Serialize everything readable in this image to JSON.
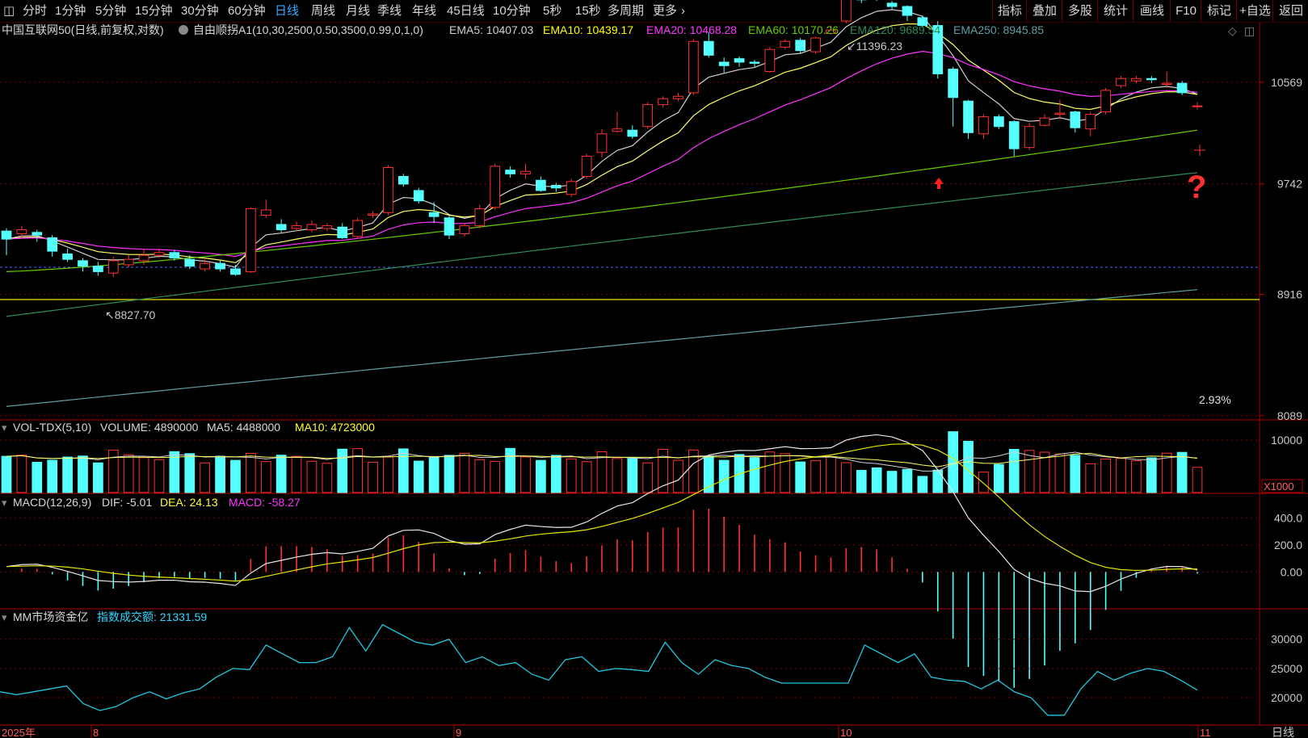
{
  "toolbar": {
    "menu_icon": "grid-icon",
    "periods": [
      "分时",
      "1分钟",
      "5分钟",
      "15分钟",
      "30分钟",
      "60分钟",
      "日线",
      "周线",
      "月线",
      "季线",
      "年线",
      "45日线",
      "10分钟",
      "5秒",
      "15秒",
      "多周期",
      "更多"
    ],
    "active_period": "日线",
    "right_buttons": [
      "指标",
      "叠加",
      "多股",
      "统计",
      "画线",
      "F10",
      "标记",
      "+自选",
      "返回"
    ]
  },
  "main_panel": {
    "title": "中国互联网50(日线,前复权,对数)",
    "indicator": "自由顺拐A1(10,30,2500,0.50,3500,0.99,0,1,0)",
    "ema_labels": [
      {
        "text": "EMA5: 10407.03",
        "color": "#d0d0d0"
      },
      {
        "text": "EMA10: 10439.17",
        "color": "#ffff00"
      },
      {
        "text": "EMA20: 10468.28",
        "color": "#ff33ff"
      },
      {
        "text": "EMA60: 10170.26",
        "color": "#66cc00"
      },
      {
        "text": "EMA120: 9689.54",
        "color": "#2e8b57"
      },
      {
        "text": "EMA250: 8945.85",
        "color": "#5f9ea0"
      }
    ],
    "y_ticks": [
      "10569",
      "9742",
      "8916",
      "8089"
    ],
    "high_label": "11396.23",
    "low_label": "8827.70",
    "pct_label": "2.93%",
    "annotation": "?"
  },
  "vol_panel": {
    "title": "VOL-TDX(5,10)",
    "volume": "VOLUME: 4890000",
    "ma5": "MA5: 4488000",
    "ma10": "MA10: 4723000",
    "y_ticks": [
      "10000"
    ],
    "unit": "X1000"
  },
  "macd_panel": {
    "title": "MACD(12,26,9)",
    "dif": "DIF: -5.01",
    "dea": "DEA: 24.13",
    "macd": "MACD: -58.27",
    "y_ticks": [
      "400.0",
      "200.0",
      "0.00"
    ]
  },
  "mm_panel": {
    "title": "MM市场资金亿",
    "label": "指数成交额: 21331.59",
    "y_ticks": [
      "30000",
      "25000",
      "20000"
    ]
  },
  "x_axis": {
    "year": "2025年",
    "months": [
      "8",
      "9",
      "10",
      "11"
    ],
    "period_label": "日线"
  },
  "chart_data": {
    "type": "candlestick",
    "title": "中国互联网50(日线,前复权,对数)",
    "y_scale": "log",
    "ylim": [
      8089,
      11000
    ],
    "candles": [
      [
        9380,
        9320,
        9400,
        9200
      ],
      [
        9360,
        9390,
        9420,
        9330
      ],
      [
        9370,
        9350,
        9390,
        9300
      ],
      [
        9330,
        9230,
        9350,
        9190
      ],
      [
        9210,
        9170,
        9250,
        9150
      ],
      [
        9160,
        9120,
        9180,
        9080
      ],
      [
        9120,
        9080,
        9150,
        9050
      ],
      [
        9070,
        9160,
        9190,
        9040
      ],
      [
        9130,
        9170,
        9200,
        9110
      ],
      [
        9160,
        9200,
        9250,
        9130
      ],
      [
        9200,
        9220,
        9250,
        9180
      ],
      [
        9220,
        9180,
        9240,
        9160
      ],
      [
        9170,
        9120,
        9200,
        9100
      ],
      [
        9100,
        9140,
        9170,
        9080
      ],
      [
        9140,
        9100,
        9160,
        9080
      ],
      [
        9100,
        9060,
        9130,
        9050
      ],
      [
        9080,
        9550,
        9560,
        9070
      ],
      [
        9500,
        9540,
        9620,
        9480
      ],
      [
        9430,
        9390,
        9470,
        9370
      ],
      [
        9400,
        9420,
        9450,
        9380
      ],
      [
        9390,
        9430,
        9460,
        9370
      ],
      [
        9400,
        9420,
        9440,
        9380
      ],
      [
        9410,
        9330,
        9440,
        9320
      ],
      [
        9340,
        9460,
        9480,
        9320
      ],
      [
        9500,
        9510,
        9530,
        9480
      ],
      [
        9520,
        9870,
        9890,
        9500
      ],
      [
        9800,
        9740,
        9820,
        9720
      ],
      [
        9690,
        9610,
        9710,
        9590
      ],
      [
        9520,
        9490,
        9600,
        9440
      ],
      [
        9480,
        9350,
        9500,
        9320
      ],
      [
        9360,
        9420,
        9440,
        9340
      ],
      [
        9420,
        9550,
        9580,
        9400
      ],
      [
        9560,
        9880,
        9900,
        9540
      ],
      [
        9850,
        9820,
        9880,
        9790
      ],
      [
        9820,
        9840,
        9900,
        9780
      ],
      [
        9770,
        9690,
        9800,
        9680
      ],
      [
        9730,
        9710,
        9750,
        9680
      ],
      [
        9660,
        9760,
        9780,
        9640
      ],
      [
        9800,
        9960,
        9980,
        9780
      ],
      [
        9990,
        10140,
        10180,
        9950
      ],
      [
        10160,
        10180,
        10320,
        10150
      ],
      [
        10170,
        10120,
        10210,
        10100
      ],
      [
        10200,
        10380,
        10400,
        10180
      ],
      [
        10380,
        10430,
        10450,
        10360
      ],
      [
        10430,
        10450,
        10480,
        10410
      ],
      [
        10480,
        10920,
        10940,
        10460
      ],
      [
        10920,
        10800,
        11000,
        10780
      ],
      [
        10740,
        10710,
        10780,
        10650
      ],
      [
        10770,
        10740,
        10790,
        10700
      ],
      [
        10740,
        10730,
        10760,
        10700
      ],
      [
        10660,
        10850,
        10870,
        10650
      ],
      [
        10870,
        10920,
        10940,
        10850
      ],
      [
        10930,
        10840,
        10950,
        10820
      ],
      [
        10830,
        10950,
        10960,
        10810
      ],
      [
        10990,
        11020,
        11060,
        10980
      ],
      [
        11100,
        11320,
        11340,
        11080
      ],
      [
        11310,
        11290,
        11320,
        11260
      ],
      [
        11320,
        11300,
        11340,
        11280
      ],
      [
        11260,
        11230,
        11280,
        11200
      ],
      [
        11230,
        11150,
        11240,
        11100
      ],
      [
        11130,
        11060,
        11150,
        11050
      ],
      [
        11060,
        10640,
        11100,
        10600
      ],
      [
        10680,
        10440,
        10700,
        10200
      ],
      [
        10410,
        10150,
        10420,
        10100
      ],
      [
        10140,
        10280,
        10300,
        10100
      ],
      [
        10280,
        10200,
        10300,
        10180
      ],
      [
        10240,
        10020,
        10250,
        9960
      ],
      [
        10030,
        10200,
        10230,
        10010
      ],
      [
        10210,
        10270,
        10300,
        10200
      ],
      [
        10300,
        10310,
        10420,
        10260
      ],
      [
        10320,
        10190,
        10330,
        10150
      ],
      [
        10180,
        10300,
        10320,
        10120
      ],
      [
        10320,
        10500,
        10520,
        10300
      ],
      [
        10540,
        10600,
        10620,
        10520
      ],
      [
        10580,
        10600,
        10620,
        10560
      ],
      [
        10600,
        10590,
        10620,
        10560
      ],
      [
        10550,
        10560,
        10660,
        10520
      ],
      [
        10560,
        10480,
        10580,
        10460
      ],
      [
        10370,
        10370,
        10400,
        10340
      ]
    ],
    "ema_series": [
      "EMA5",
      "EMA10",
      "EMA20",
      "EMA60",
      "EMA120",
      "EMA250"
    ],
    "volume": {
      "unit": "X1000",
      "ylim": [
        0,
        12000
      ]
    },
    "macd": {
      "ylim": [
        -250,
        500
      ]
    },
    "turnover": {
      "ylim": [
        16000,
        33000
      ],
      "values": [
        21000,
        20500,
        21000,
        21500,
        22000,
        19000,
        17800,
        18500,
        20000,
        21000,
        19800,
        20800,
        21500,
        23500,
        25000,
        24800,
        29000,
        27500,
        26000,
        26000,
        27000,
        32000,
        28000,
        32500,
        31000,
        29500,
        29000,
        30000,
        26000,
        27000,
        25500,
        26000,
        24000,
        23000,
        26500,
        27000,
        24500,
        25000,
        24800,
        24500,
        29500,
        26000,
        24000,
        26500,
        25500,
        25000,
        23500,
        22500,
        22500,
        22500,
        22500,
        22500,
        29000,
        27500,
        26000,
        27500,
        23500,
        23000,
        22800,
        21500,
        23000,
        21000,
        20000,
        17000,
        17000,
        21500,
        24500,
        23000,
        24200,
        25000,
        24500,
        23000,
        21300
      ]
    }
  }
}
